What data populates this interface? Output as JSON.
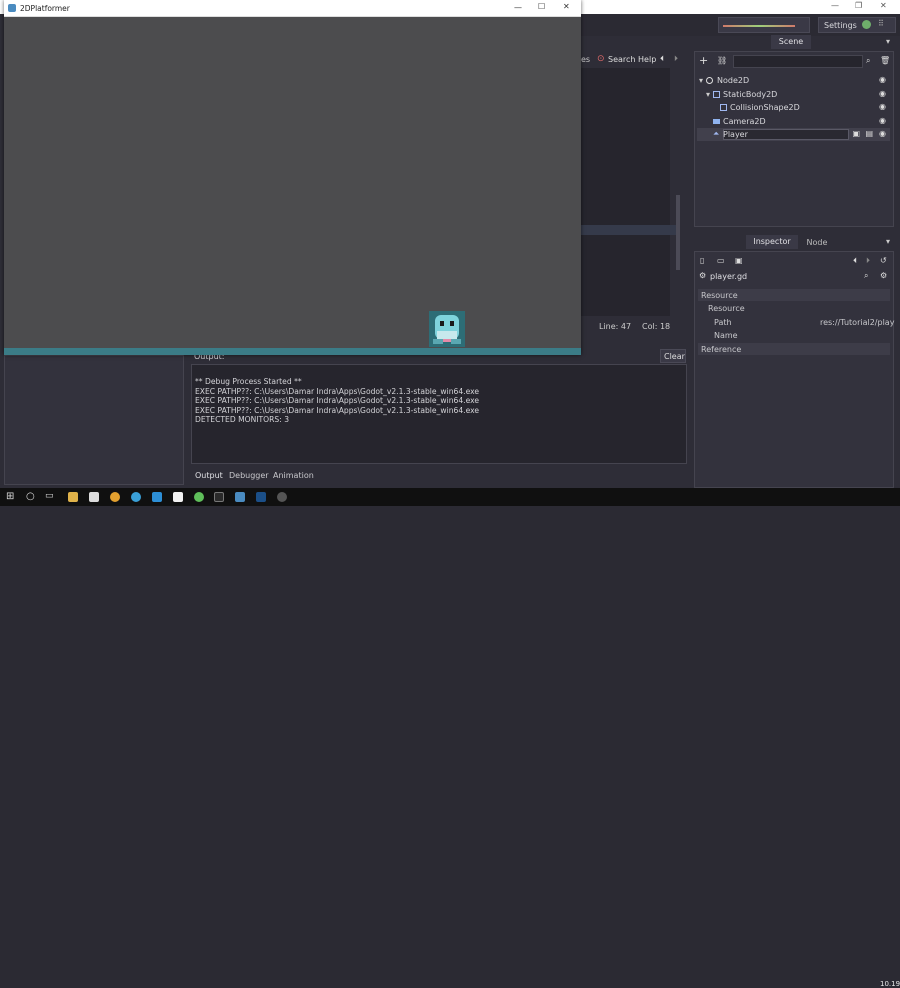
{
  "editor": {
    "settings_label": "Settings",
    "script_toolbar": {
      "classes_tail": "es",
      "search_help": "Search Help"
    },
    "status": {
      "line": "Line: 47",
      "col": "Col: 18"
    },
    "scene_dock": {
      "tab": "Scene",
      "tree": [
        {
          "label": "Node2D",
          "icon": "node2d-icon"
        },
        {
          "label": "StaticBody2D",
          "icon": "staticbody-icon"
        },
        {
          "label": "CollisionShape2D",
          "icon": "collision-shape-icon"
        },
        {
          "label": "Camera2D",
          "icon": "camera-icon"
        },
        {
          "label": "Player",
          "icon": "kinematic-icon"
        }
      ]
    },
    "inspector": {
      "tabs": [
        "Inspector",
        "Node"
      ],
      "resource_name": "player.gd",
      "sections": {
        "resource": "Resource",
        "resource_sub": "Resource",
        "path_label": "Path",
        "path_value": "res://Tutorial2/play",
        "name_label": "Name",
        "reference": "Reference"
      }
    },
    "output": {
      "title": "Output:",
      "clear_label": "Clear",
      "lines": [
        "** Debug Process Started **",
        "EXEC PATHP??: C:\\Users\\Damar Indra\\Apps\\Godot_v2.1.3-stable_win64.exe",
        "EXEC PATHP??: C:\\Users\\Damar Indra\\Apps\\Godot_v2.1.3-stable_win64.exe",
        "EXEC PATHP??: C:\\Users\\Damar Indra\\Apps\\Godot_v2.1.3-stable_win64.exe",
        "DETECTED MONITORS: 3"
      ],
      "tabs": [
        "Output",
        "Debugger",
        "Animation"
      ]
    }
  },
  "game_window": {
    "title": "2DPlatformer",
    "bg_color": "#4c4c4e",
    "ground_color": "#3b7c87"
  },
  "taskbar": {
    "clock": "10.19"
  }
}
